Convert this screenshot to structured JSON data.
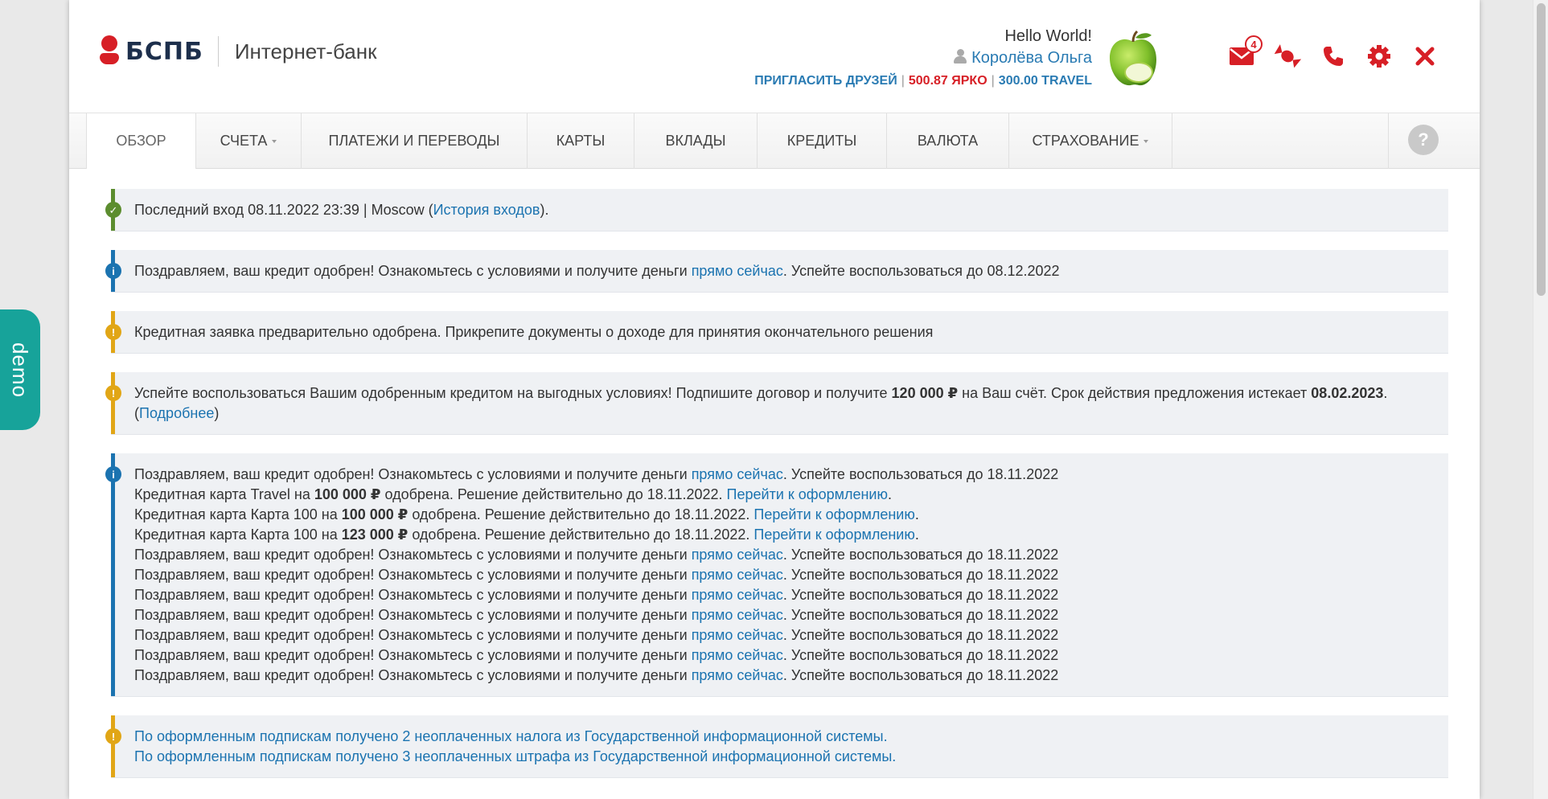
{
  "brand": {
    "logo_text": "БСПБ",
    "subtitle": "Интернет-банк",
    "accent_color": "#d71f26",
    "link_color": "#1b73b0"
  },
  "user": {
    "greeting": "Hello World!",
    "name": "Королёва Ольга",
    "invite_label": "ПРИГЛАСИТЬ ДРУЗЕЙ",
    "bright_points": "500.87 ЯРКО",
    "travel_points": "300.00 TRAVEL"
  },
  "header_icons": {
    "mail_badge_count": "4",
    "icons": [
      "mail-icon",
      "candy-icon",
      "phone-icon",
      "gear-icon",
      "close-icon"
    ]
  },
  "nav": {
    "items": [
      {
        "label": "Обзор",
        "active": true,
        "dropdown": false
      },
      {
        "label": "Счета",
        "active": false,
        "dropdown": true
      },
      {
        "label": "Платежи и переводы",
        "active": false,
        "dropdown": false
      },
      {
        "label": "Карты",
        "active": false,
        "dropdown": false
      },
      {
        "label": "Вклады",
        "active": false,
        "dropdown": false
      },
      {
        "label": "Кредиты",
        "active": false,
        "dropdown": false
      },
      {
        "label": "Валюта",
        "active": false,
        "dropdown": false
      },
      {
        "label": "Страхование",
        "active": false,
        "dropdown": true
      }
    ],
    "help_label": "?"
  },
  "alerts": {
    "last_login": {
      "text": "Последний вход 08.11.2022 23:39 | Moscow (",
      "link": "История входов",
      "tail": ")."
    },
    "credit_approved": {
      "text": "Поздравляем, ваш кредит одобрен! Ознакомьтесь с условиями и получите деньги ",
      "link": "прямо сейчас",
      "tail": ". Успейте воспользоваться до 08.12.2022"
    },
    "docs_required": {
      "text": "Кредитная заявка предварительно одобрена. Прикрепите документы о доходе для принятия окончательного решения"
    },
    "offer": {
      "text1": "Успейте воспользоваться Вашим одобренным кредитом на выгодных условиях! Подпишите договор и получите ",
      "amount": "120 000 ₽",
      "text2": " на Ваш счёт. Срок действия предложения истекает ",
      "date": "08.02.2023",
      "text3": ". (",
      "link": "Подробнее",
      "tail": ")"
    },
    "multi": {
      "credit_text": "Поздравляем, ваш кредит одобрен! Ознакомьтесь с условиями и получите деньги ",
      "credit_link": "прямо сейчас",
      "credit_tail": ". Успейте воспользоваться до 18.11.2022",
      "card1_pre": "Кредитная карта Travel на ",
      "card1_amount": "100 000 ₽",
      "card2_pre": "Кредитная карта Карта 100 на ",
      "card2_amount": "100 000 ₽",
      "card3_pre": "Кредитная карта Карта 100 на ",
      "card3_amount": "123 000 ₽",
      "card_post": " одобрена. Решение действительно до 18.11.2022. ",
      "card_link": "Перейти к оформлению",
      "card_tail": "."
    },
    "gis": {
      "line1": "По оформленным подпискам получено 2 неоплаченных налога из Государственной информационной системы.",
      "line2": "По оформленным подпискам получено 3 неоплаченных штрафа из Государственной информационной системы."
    }
  },
  "demo_label": "demo"
}
